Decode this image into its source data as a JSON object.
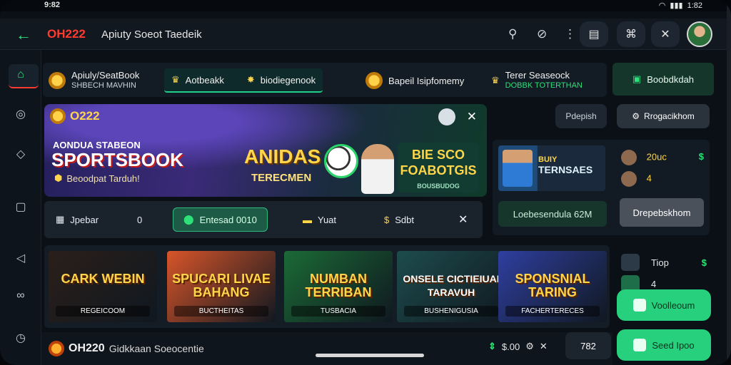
{
  "status_bar": {
    "time": "9:82",
    "right_text": "1:82"
  },
  "topbar": {
    "brand": "OH222",
    "subtitle": "Apiuty Soeot Taedeik",
    "icons": [
      "search-icon",
      "compass-icon",
      "more-icon",
      "ticket-icon",
      "gift-icon",
      "settings-icon"
    ]
  },
  "tabs": [
    {
      "title": "Apiuly/SeatBook",
      "subtitle": "SHBECH MAVHIN",
      "icon": "coin-icon"
    },
    {
      "title": "Aotbeakk",
      "icon": "trophy-icon"
    },
    {
      "title": "biodiegenook",
      "icon": "medal-icon",
      "active": true
    },
    {
      "title": "Bapeil Isipfomemy",
      "icon": "coin-icon"
    },
    {
      "title": "Terer Seaseock",
      "subtitle": "DOBBK TOTERTHAN",
      "icon": "trophy-icon"
    }
  ],
  "green_pill": {
    "label": "Boobdkdah",
    "icon": "shop-icon"
  },
  "hero": {
    "brand": "O222",
    "line1": "AONDUA STABEON",
    "line2": "SPORTSBOOK",
    "line3": "Beoodpat Tarduh!",
    "badge": "ANIDAS",
    "badge2": "TERECMEN",
    "promo_title": "BIE SCO FOABOTGIS",
    "promo_sub": "BOUSBUDOG"
  },
  "right_buttons": {
    "small": "Pdepish",
    "large": "Rrogacikhom"
  },
  "filters": [
    {
      "label": "Jpebar",
      "icon": "box-icon"
    },
    {
      "label": "0"
    },
    {
      "label": "Entesad 0010",
      "icon": "shield-icon",
      "active": true
    },
    {
      "label": "Yuat",
      "icon": "folder-icon"
    },
    {
      "label": "Sdbt",
      "icon": "dollar-icon"
    }
  ],
  "right_panel": {
    "card_title": "BUIY",
    "card_sub": "TERNSAES",
    "stat1": "20uc",
    "stat2": "4",
    "green": "$",
    "button1": "Loebesendula 62M",
    "button2": "Drepebskhom"
  },
  "games": [
    {
      "title": "CARK WEBIN",
      "sub": "REGEICOOM",
      "bg": "#2a1f1a"
    },
    {
      "title": "SPUCARI LIVAE BAHANG",
      "sub": "BUCTHEITAS",
      "bg": "#d8552a"
    },
    {
      "title": "NUMBAN TERRIBAN",
      "sub": "TUSBACIA",
      "bg": "#1b6a36"
    },
    {
      "title": "ONSELE CICTIEIUAI TARAVUH",
      "sub": "BUSHENIGUSIA",
      "bg": "#1d4c4d"
    },
    {
      "title": "SPONSNIAL TARING",
      "sub": "FACHERTERECES",
      "bg": "#2f3fa0"
    }
  ],
  "side_list": [
    {
      "label": "Tiop",
      "g": "$"
    },
    {
      "label": "4"
    }
  ],
  "cta": [
    {
      "label": "Voolleoum",
      "icon": "edit-icon"
    },
    {
      "label": "Seed Ipoo",
      "icon": "chat-icon"
    }
  ],
  "bottombar": {
    "brand": "OH220",
    "text": "Gidkkaan Soeocentie",
    "balance": "$.00",
    "chip": "782"
  }
}
